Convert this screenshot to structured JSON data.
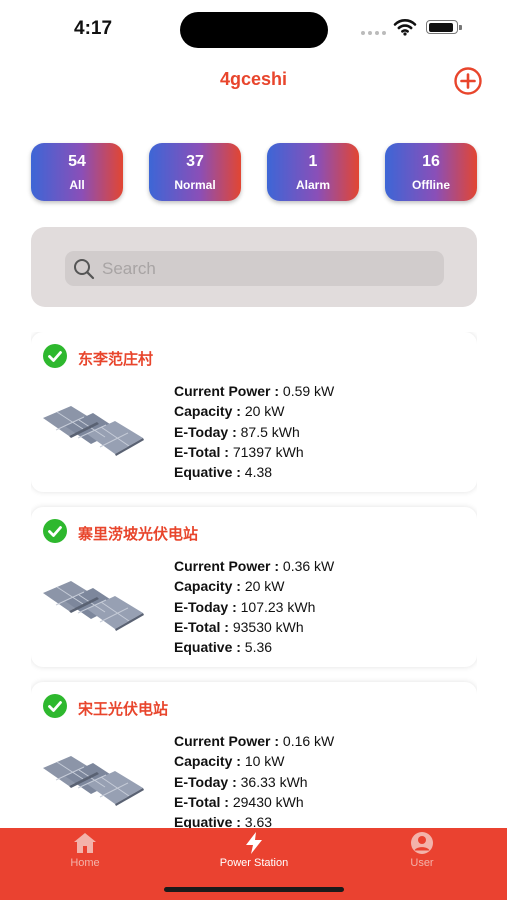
{
  "status_bar": {
    "time": "4:17"
  },
  "header": {
    "title": "4gceshi",
    "add_icon": "plus-circle-icon"
  },
  "colors": {
    "accent": "#e8452c",
    "tab_bar": "#ea4230",
    "success": "#2eb82e"
  },
  "stats": [
    {
      "count": "54",
      "label": "All"
    },
    {
      "count": "37",
      "label": "Normal"
    },
    {
      "count": "1",
      "label": "Alarm"
    },
    {
      "count": "16",
      "label": "Offline"
    }
  ],
  "search": {
    "placeholder": "Search",
    "icon": "search-icon"
  },
  "stations": [
    {
      "name": "东李范庄村",
      "status_icon": "check-circle-icon",
      "current_power_label": "Current Power :",
      "current_power": "0.59 kW",
      "capacity_label": "Capacity :",
      "capacity": "20 kW",
      "e_today_label": "E-Today :",
      "e_today": "87.5 kWh",
      "e_total_label": "E-Total :",
      "e_total": "71397 kWh",
      "equative_label": "Equative :",
      "equative": "4.38"
    },
    {
      "name": "寨里涝坡光伏电站",
      "status_icon": "check-circle-icon",
      "current_power_label": "Current Power :",
      "current_power": "0.36 kW",
      "capacity_label": "Capacity :",
      "capacity": "20 kW",
      "e_today_label": "E-Today :",
      "e_today": "107.23 kWh",
      "e_total_label": "E-Total :",
      "e_total": "93530 kWh",
      "equative_label": "Equative :",
      "equative": "5.36"
    },
    {
      "name": "宋王光伏电站",
      "status_icon": "check-circle-icon",
      "current_power_label": "Current Power :",
      "current_power": "0.16 kW",
      "capacity_label": "Capacity :",
      "capacity": "10 kW",
      "e_today_label": "E-Today :",
      "e_today": "36.33 kWh",
      "e_total_label": "E-Total :",
      "e_total": "29430 kWh",
      "equative_label": "Equative :",
      "equative": "3.63"
    }
  ],
  "tabs": [
    {
      "label": "Home",
      "icon": "home-icon",
      "active": false
    },
    {
      "label": "Power Station",
      "icon": "lightning-icon",
      "active": true
    },
    {
      "label": "User",
      "icon": "user-icon",
      "active": false
    }
  ]
}
